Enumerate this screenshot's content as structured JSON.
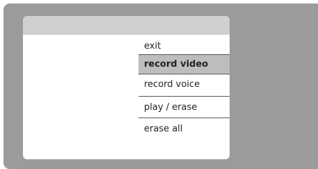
{
  "menu": {
    "items": [
      {
        "label": "exit",
        "selected": false
      },
      {
        "label": "record video",
        "selected": true
      },
      {
        "label": "record voice",
        "selected": false
      },
      {
        "label": "play / erase",
        "selected": false
      },
      {
        "label": "erase all",
        "selected": false
      }
    ]
  },
  "colors": {
    "device_bezel": "#9b9b9d",
    "header_bar": "#d0d0d2",
    "selected_item": "#bdbdbf",
    "divider": "#555555"
  }
}
